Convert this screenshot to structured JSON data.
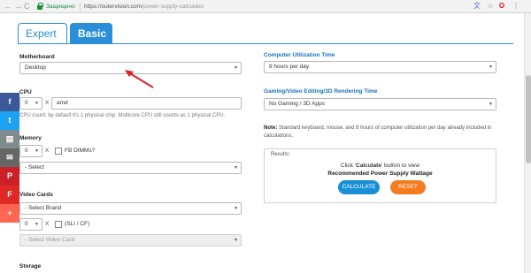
{
  "browser": {
    "back_glyph": "←",
    "forward_glyph": "→",
    "reload_glyph": "C",
    "secure_label": "Защищено",
    "url_host": "https://outervision.com",
    "url_path": "/power-supply-calculator",
    "ext_translate": "文",
    "ext_star": "☆",
    "ext_o": "O",
    "ext_menu": "⋮"
  },
  "tabs": [
    {
      "label": "Expert",
      "active": false
    },
    {
      "label": "Basic",
      "active": true
    }
  ],
  "left": {
    "motherboard": {
      "label": "Motherboard",
      "value": "Desktop"
    },
    "cpu": {
      "label": "CPU",
      "qty": "0",
      "x": "X",
      "value": "amd",
      "help": "CPU count: by default it's 1 physical chip. Multicore CPU still counts as 1 physical CPU."
    },
    "memory": {
      "label": "Memory",
      "qty": "0",
      "x": "X",
      "fb_label": "FB DIMMs?",
      "select": "- Select"
    },
    "video": {
      "label": "Video Cards",
      "brand": "- Select Brand",
      "qty": "0",
      "x": "X",
      "sli_label": "(SLI / CF)",
      "card": "- Select Video Card"
    },
    "storage": {
      "label": "Storage"
    }
  },
  "right": {
    "utilization": {
      "label": "Computer Utilization Time",
      "value": "8 hours per day"
    },
    "gaming": {
      "label": "Gaming/Video Editing/3D Rendering Time",
      "value": "No Gaming / 3D Apps"
    },
    "note_bold": "Note:",
    "note_text": "Standard keyboard, mouse, and 8 hours of computer utilization per day already included in calculations.",
    "results": {
      "title": "Results:",
      "line1_pre": "Click '",
      "line1_bold": "Calculate",
      "line1_post": "' button to view",
      "line2": "Recommended Power Supply Wattage",
      "calculate": "CALCULATE",
      "reset": "RESET"
    }
  },
  "share": [
    {
      "icon": "facebook-icon",
      "glyph": "f",
      "color": "#3b5998"
    },
    {
      "icon": "twitter-icon",
      "glyph": "t",
      "color": "#1da1f2"
    },
    {
      "icon": "print-icon",
      "glyph": "▤",
      "color": "#7f8c8d"
    },
    {
      "icon": "email-icon",
      "glyph": "✉",
      "color": "#666666"
    },
    {
      "icon": "pinterest-icon",
      "glyph": "P",
      "color": "#cb2027"
    },
    {
      "icon": "flipboard-icon",
      "glyph": "F",
      "color": "#e12828"
    },
    {
      "icon": "more-share-icon",
      "glyph": "+",
      "color": "#ff6550"
    }
  ],
  "colors": {
    "accent": "#2a8fd8",
    "calculate": "#1a8fd6",
    "reset": "#f47c20",
    "arrow": "#e02020"
  }
}
